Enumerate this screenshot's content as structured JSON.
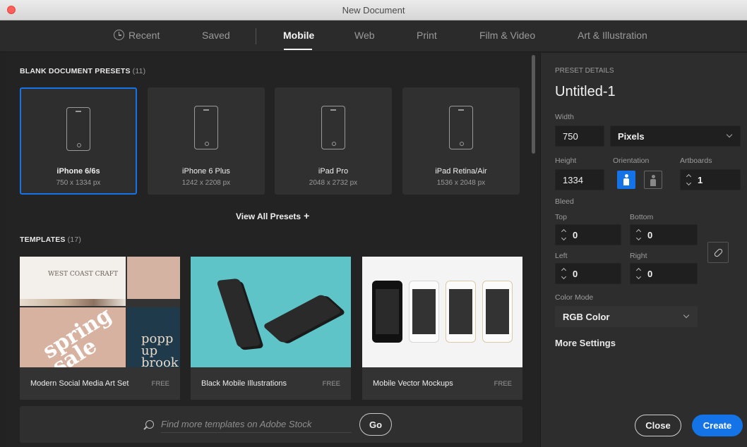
{
  "window": {
    "title": "New Document"
  },
  "tabs": [
    {
      "label": "Recent"
    },
    {
      "label": "Saved"
    },
    {
      "label": "Mobile"
    },
    {
      "label": "Web"
    },
    {
      "label": "Print"
    },
    {
      "label": "Film & Video"
    },
    {
      "label": "Art & Illustration"
    }
  ],
  "presets_section": {
    "title": "BLANK DOCUMENT PRESETS",
    "count": "(11)"
  },
  "presets": [
    {
      "name": "iPhone 6/6s",
      "size": "750 x 1334 px"
    },
    {
      "name": "iPhone 6 Plus",
      "size": "1242 x 2208 px"
    },
    {
      "name": "iPad Pro",
      "size": "2048 x 2732 px"
    },
    {
      "name": "iPad Retina/Air",
      "size": "1536 x 2048 px"
    }
  ],
  "view_all_label": "View All Presets",
  "templates_section": {
    "title": "TEMPLATES",
    "count": "(17)"
  },
  "templates": [
    {
      "name": "Modern Social Media Art Set",
      "price": "FREE",
      "thumb_text_1": "WEST COAST CRAFT",
      "thumb_text_2": "spring sale",
      "thumb_text_3": "popp up brook"
    },
    {
      "name": "Black Mobile Illustrations",
      "price": "FREE"
    },
    {
      "name": "Mobile Vector Mockups",
      "price": "FREE"
    }
  ],
  "search": {
    "placeholder": "Find more templates on Adobe Stock",
    "go_label": "Go"
  },
  "details": {
    "section_title": "PRESET DETAILS",
    "doc_name": "Untitled-1",
    "width_label": "Width",
    "width_value": "750",
    "units": "Pixels",
    "height_label": "Height",
    "height_value": "1334",
    "orientation_label": "Orientation",
    "artboards_label": "Artboards",
    "artboards_value": "1",
    "bleed_label": "Bleed",
    "top_label": "Top",
    "top_value": "0",
    "bottom_label": "Bottom",
    "bottom_value": "0",
    "left_label": "Left",
    "left_value": "0",
    "right_label": "Right",
    "right_value": "0",
    "color_mode_label": "Color Mode",
    "color_mode_value": "RGB Color",
    "more_settings_label": "More Settings"
  },
  "actions": {
    "close_label": "Close",
    "create_label": "Create"
  },
  "colors": {
    "accent": "#1473e6",
    "panel_bg": "#2d2d2d",
    "main_bg": "#232323"
  }
}
